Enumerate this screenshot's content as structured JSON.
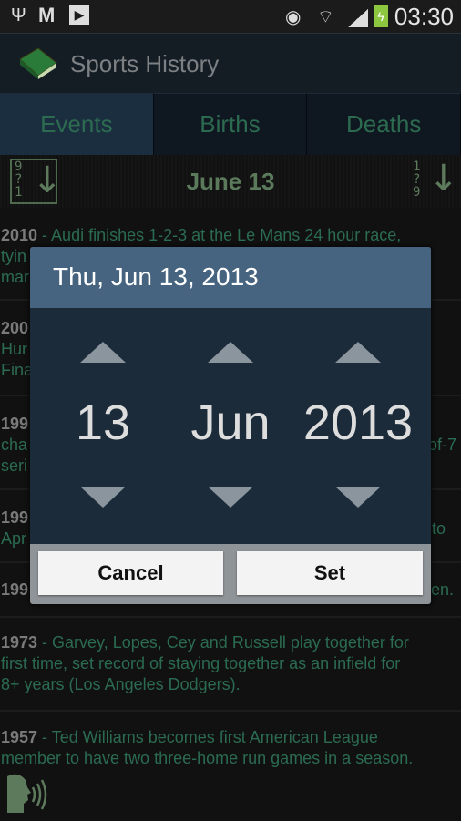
{
  "status_bar": {
    "time": "03:30",
    "icons": [
      "usb-icon",
      "gmail-icon",
      "play-store-icon",
      "eye-icon",
      "wifi-icon",
      "signal-icon",
      "battery-charging-icon"
    ],
    "battery_color": "#8dc63f"
  },
  "app": {
    "title": "Sports History",
    "icon": "green-book-icon"
  },
  "tabs": [
    {
      "label": "Events",
      "active": true
    },
    {
      "label": "Births",
      "active": false
    },
    {
      "label": "Deaths",
      "active": false
    }
  ],
  "sort_bar": {
    "date": "June 13",
    "sort_desc_icon": "sort-9-1-icon",
    "sort_asc_icon": "sort-1-9-icon"
  },
  "events": [
    {
      "year": "2010",
      "lines": [
        " - Audi finishes 1-2-3 at the Le Mans 24 hour race,",
        "tyin",
        "mar"
      ]
    },
    {
      "year": "200",
      "lines": [
        "Hur",
        "Fina"
      ]
    },
    {
      "year": "199",
      "lines": [
        "cha",
        "seri"
      ],
      "right": "of-7"
    },
    {
      "year": "199",
      "lines": [
        "Apr"
      ],
      "right": "to"
    },
    {
      "year": "199",
      "lines": [],
      "right": "en."
    },
    {
      "year": "1973",
      "lines": [
        " - Garvey, Lopes, Cey and Russell play together for",
        "first time, set record of staying together as an infield for",
        "8+ years (Los Angeles Dodgers)."
      ]
    },
    {
      "year": "1957",
      "lines": [
        " - Ted Williams becomes first American League",
        "member to have two three-home run games in a season."
      ]
    }
  ],
  "dialog": {
    "title": "Thu, Jun 13, 2013",
    "day": "13",
    "month": "Jun",
    "year": "2013",
    "cancel": "Cancel",
    "set": "Set"
  },
  "colors": {
    "text_green": "#2b6b52",
    "dialog_header": "#46647f",
    "dialog_body": "#1c2b3a"
  }
}
